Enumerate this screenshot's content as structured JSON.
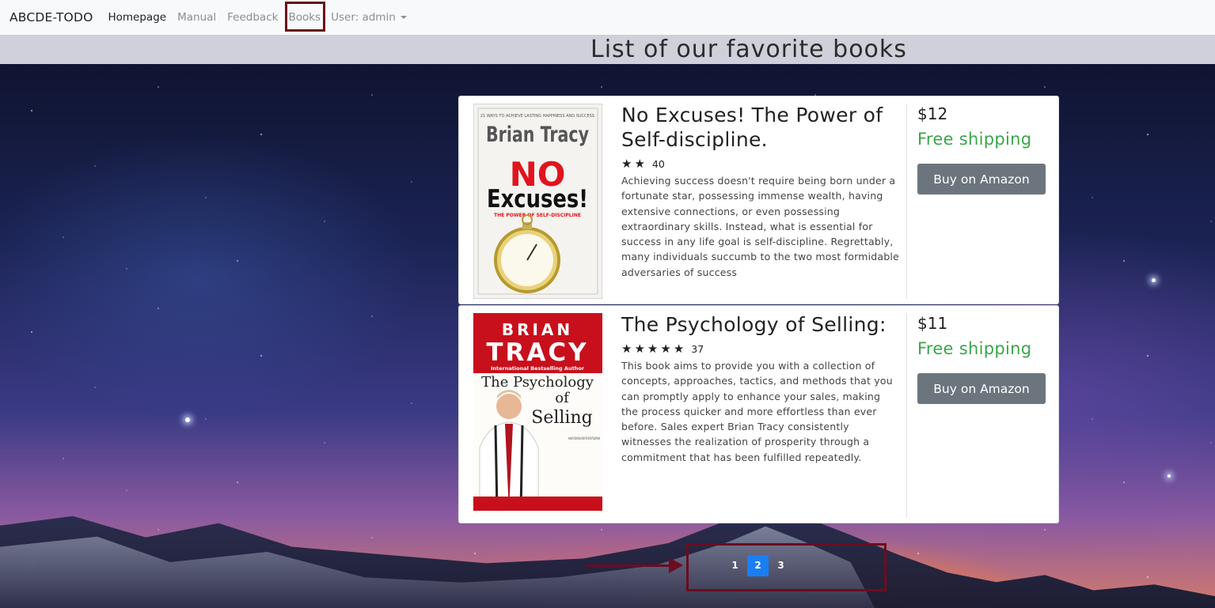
{
  "navbar": {
    "brand": "ABCDE-TODO",
    "links": [
      {
        "label": "Homepage"
      },
      {
        "label": "Manual"
      },
      {
        "label": "Feedback"
      },
      {
        "label": "Books"
      }
    ],
    "user_label": "User: admin"
  },
  "page": {
    "title": "List of our favorite books"
  },
  "books": [
    {
      "cover_text": {
        "tagline": "21 WAYS TO ACHIEVE LASTING HAPPINESS AND SUCCESS",
        "author": "Brian Tracy",
        "title_line1": "NO",
        "title_line2": "Excuses!",
        "subtitle": "THE POWER OF SELF-DISCIPLINE"
      },
      "title": "No Excuses! The Power of Self-discipline.",
      "rating_stars": 2,
      "rating_count": "40",
      "description": "Achieving success doesn't require being born under a fortunate star, possessing immense wealth, having extensive connections, or even possessing extraordinary skills. Instead, what is essential for success in any life goal is self-discipline. Regrettably, many individuals succumb to the two most formidable adversaries of success",
      "price": "$12",
      "shipping": "Free shipping",
      "buy_label": "Buy on Amazon"
    },
    {
      "cover_text": {
        "author_first": "BRIAN",
        "author_last": "TRACY",
        "tagline": "International Bestselling Author",
        "title_line1": "The Psychology",
        "title_line2": "of",
        "title_line3": "Selling",
        "blurb": "Increase Your Sales Faster and Easier Than You Ever Thought Possible"
      },
      "title": "The Psychology of Selling:",
      "rating_stars": 5,
      "rating_count": "37",
      "description": "This book aims to provide you with a collection of concepts, approaches, tactics, and methods that you can promptly apply to enhance your sales, making the process quicker and more effortless than ever before. Sales expert Brian Tracy consistently witnesses the realization of prosperity through a commitment that has been fulfilled repeatedly.",
      "price": "$11",
      "shipping": "Free shipping",
      "buy_label": "Buy on Amazon"
    }
  ],
  "pagination": {
    "pages": [
      "1",
      "2",
      "3"
    ],
    "current": "2"
  },
  "colors": {
    "annotation": "#6b0d1f",
    "accent": "#1a7ef5",
    "shipping": "#3aa64a",
    "button": "#6c757d"
  }
}
